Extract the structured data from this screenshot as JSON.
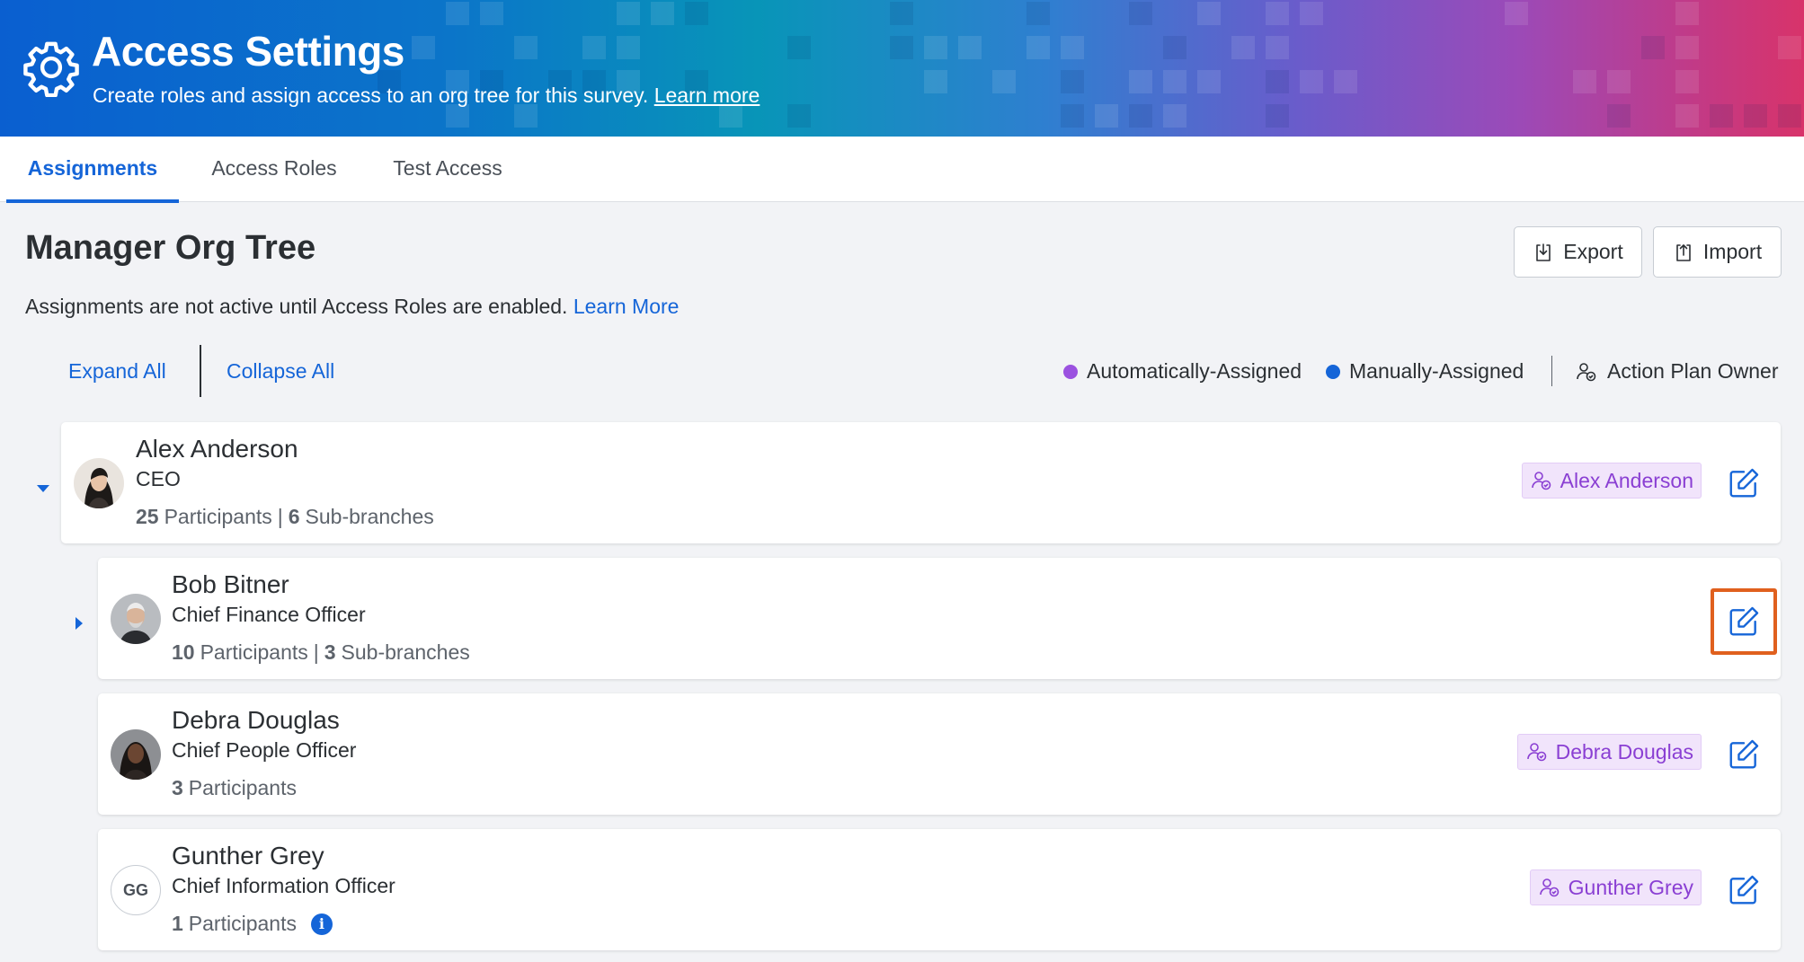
{
  "header": {
    "title": "Access Settings",
    "subtitle": "Create roles and assign access to an org tree for this survey.",
    "learn_more": "Learn more",
    "icon": "gear-icon"
  },
  "tabs": [
    {
      "label": "Assignments",
      "active": true
    },
    {
      "label": "Access Roles",
      "active": false
    },
    {
      "label": "Test Access",
      "active": false
    }
  ],
  "main": {
    "title": "Manager Org Tree",
    "notice": "Assignments are not active until Access Roles are enabled.",
    "notice_link": "Learn More",
    "export_label": "Export",
    "import_label": "Import",
    "expand_all": "Expand All",
    "collapse_all": "Collapse All",
    "legend": {
      "auto": "Automatically-Assigned",
      "manual": "Manually-Assigned",
      "owner": "Action Plan Owner",
      "auto_color": "#9b51e0",
      "manual_color": "#1565d8"
    }
  },
  "tree": [
    {
      "name": "Alex Anderson",
      "role": "CEO",
      "participants": "25",
      "participants_label": "Participants",
      "sep": "|",
      "subbranches": "6",
      "subbranches_label": "Sub-branches",
      "owner": "Alex Anderson",
      "expanded": true
    },
    {
      "name": "Bob Bitner",
      "role": "Chief Finance Officer",
      "participants": "10",
      "participants_label": "Participants",
      "sep": "|",
      "subbranches": "3",
      "subbranches_label": "Sub-branches",
      "owner": "",
      "expanded": false,
      "highlighted_edit": true
    },
    {
      "name": "Debra Douglas",
      "role": "Chief People Officer",
      "participants": "3",
      "participants_label": "Participants",
      "owner": "Debra Douglas"
    },
    {
      "name": "Gunther Grey",
      "role": "Chief Information Officer",
      "participants": "1",
      "participants_label": "Participants",
      "initials": "GG",
      "owner": "Gunther Grey",
      "info_icon": "info-icon"
    }
  ],
  "colors": {
    "accent": "#1565d8",
    "owner_tag_bg": "#f1e4fb",
    "owner_tag_text": "#8a3fd3",
    "highlight": "#e0601e"
  }
}
